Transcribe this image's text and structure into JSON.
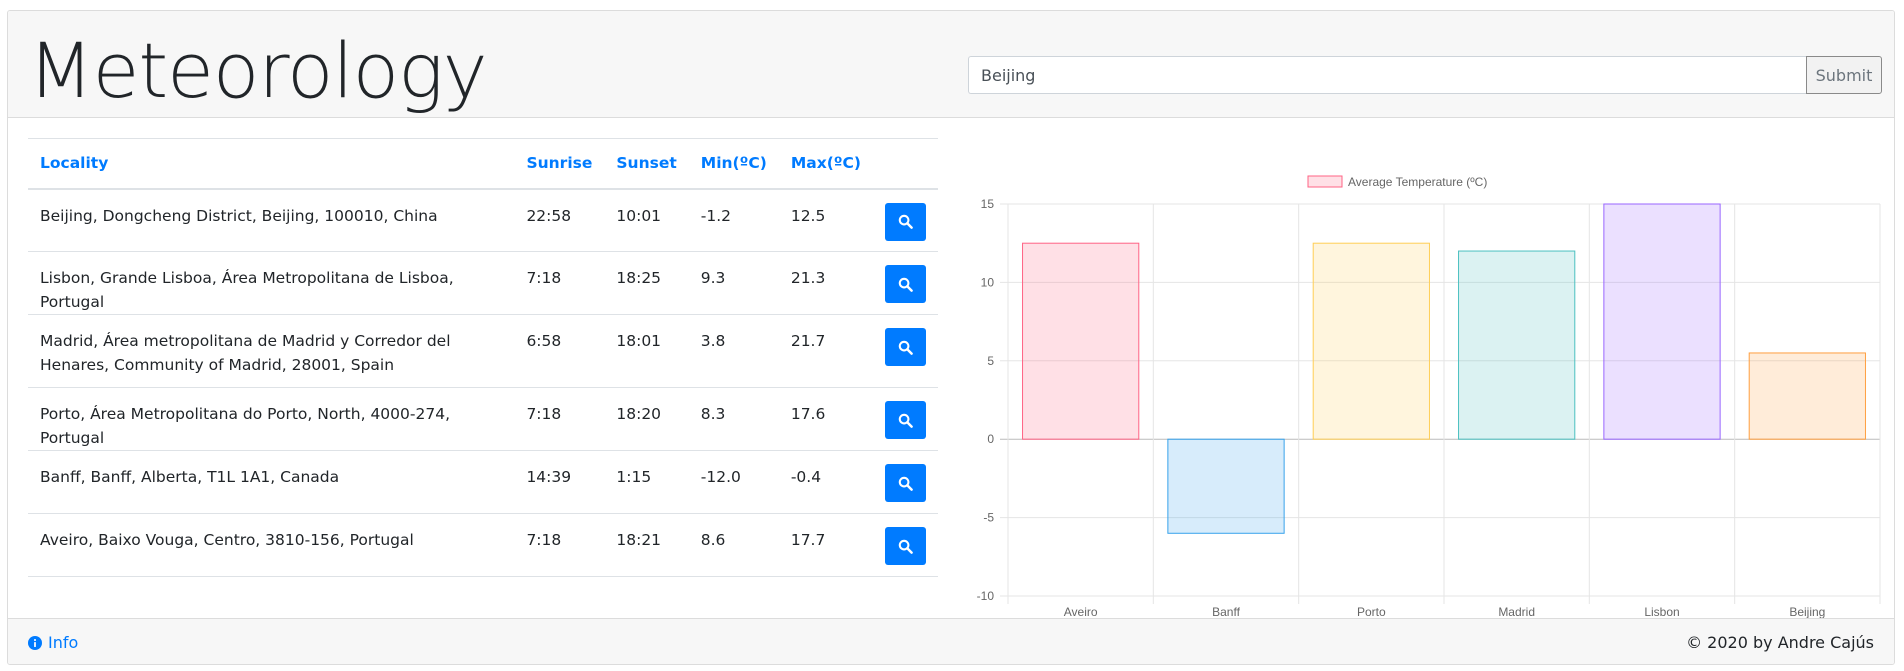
{
  "header": {
    "title": "Meteorology",
    "search_value": "Beijing",
    "submit_label": "Submit"
  },
  "table": {
    "columns": [
      "Locality",
      "Sunrise",
      "Sunset",
      "Min(ºC)",
      "Max(ºC)"
    ],
    "rows": [
      {
        "locality": "Beijing, Dongcheng District, Beijing, 100010, China",
        "sunrise": "22:58",
        "sunset": "10:01",
        "min": "-1.2",
        "max": "12.5"
      },
      {
        "locality": "Lisbon, Grande Lisboa, Área Metropolitana de Lisboa, Portugal",
        "sunrise": "7:18",
        "sunset": "18:25",
        "min": "9.3",
        "max": "21.3"
      },
      {
        "locality": "Madrid, Área metropolitana de Madrid y Corredor del Henares, Community of Madrid, 28001, Spain",
        "sunrise": "6:58",
        "sunset": "18:01",
        "min": "3.8",
        "max": "21.7"
      },
      {
        "locality": "Porto, Área Metropolitana do Porto, North, 4000-274, Portugal",
        "sunrise": "7:18",
        "sunset": "18:20",
        "min": "8.3",
        "max": "17.6"
      },
      {
        "locality": "Banff, Banff, Alberta, T1L 1A1, Canada",
        "sunrise": "14:39",
        "sunset": "1:15",
        "min": "-12.0",
        "max": "-0.4"
      },
      {
        "locality": "Aveiro, Baixo Vouga, Centro, 3810-156, Portugal",
        "sunrise": "7:18",
        "sunset": "18:21",
        "min": "8.6",
        "max": "17.7"
      }
    ],
    "row_action_icon": "search-icon"
  },
  "chart_data": {
    "type": "bar",
    "title": "",
    "legend": "Average Temperature (ºC)",
    "legend_position": "top",
    "categories": [
      "Aveiro",
      "Banff",
      "Porto",
      "Madrid",
      "Lisbon",
      "Beijing"
    ],
    "series": [
      {
        "name": "Average Temperature (ºC)",
        "values": [
          12.5,
          -6.0,
          12.5,
          12.0,
          15.0,
          5.5
        ]
      }
    ],
    "bar_colors": [
      "#ff6384",
      "#36a2eb",
      "#ffce56",
      "#4bc0c0",
      "#9966ff",
      "#ff9f40"
    ],
    "ylim": [
      -10,
      15
    ],
    "yticks": [
      15,
      10,
      5,
      0,
      -5,
      -10
    ],
    "grid": true
  },
  "footer": {
    "info_label": "Info",
    "info_icon": "info-circle-icon",
    "copyright": "© 2020 by Andre Cajús"
  },
  "colors": {
    "accent": "#007bff",
    "header_bg": "#f7f7f7"
  }
}
